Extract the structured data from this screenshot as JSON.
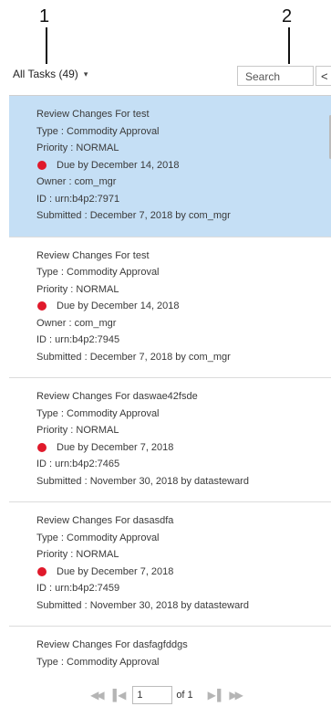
{
  "callouts": [
    "1",
    "2"
  ],
  "header": {
    "filter_label": "All Tasks (49)",
    "filter_caret": "▾",
    "search_placeholder": "Search",
    "collapse_glyph": "<"
  },
  "tasks": [
    {
      "title": "Review Changes For test",
      "type": "Type : Commodity Approval",
      "priority": "Priority : NORMAL",
      "due": "Due by December 14, 2018",
      "owner": "Owner : com_mgr",
      "id": "ID : urn:b4p2:7971",
      "submitted": "Submitted : December 7, 2018 by com_mgr",
      "selected": true
    },
    {
      "title": "Review Changes For test",
      "type": "Type : Commodity Approval",
      "priority": "Priority : NORMAL",
      "due": "Due by December 14, 2018",
      "owner": "Owner : com_mgr",
      "id": "ID : urn:b4p2:7945",
      "submitted": "Submitted : December 7, 2018 by com_mgr",
      "selected": false
    },
    {
      "title": "Review Changes For daswae42fsde",
      "type": "Type : Commodity Approval",
      "priority": "Priority : NORMAL",
      "due": "Due by December 7, 2018",
      "id": "ID : urn:b4p2:7465",
      "submitted": "Submitted : November 30, 2018 by datasteward",
      "selected": false
    },
    {
      "title": "Review Changes For dasasdfa",
      "type": "Type : Commodity Approval",
      "priority": "Priority : NORMAL",
      "due": "Due by December 7, 2018",
      "id": "ID : urn:b4p2:7459",
      "submitted": "Submitted : November 30, 2018 by datasteward",
      "selected": false
    },
    {
      "title": "Review Changes For dasfagfddgs",
      "type": "Type : Commodity Approval",
      "selected": false
    }
  ],
  "pager": {
    "first_glyph": "◀◀",
    "prev_glyph": "▌◀",
    "next_glyph": "▶▐",
    "last_glyph": "▶▶",
    "page_value": "1",
    "of_text": "of 1"
  },
  "colors": {
    "selected_bg": "#c5dff5",
    "due_dot": "#e0192b"
  }
}
